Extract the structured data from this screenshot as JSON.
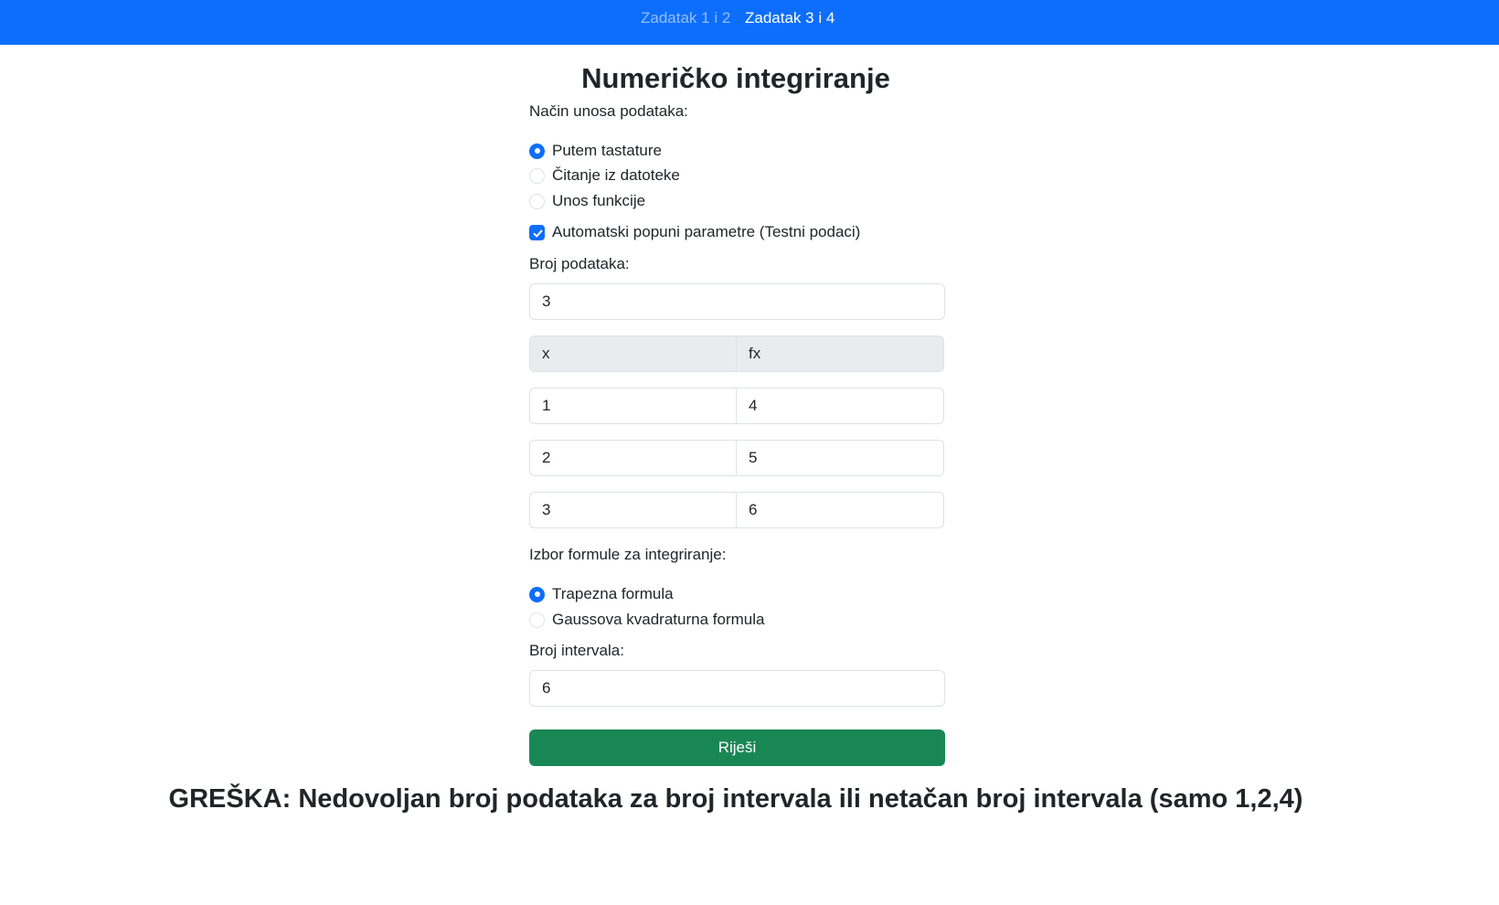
{
  "nav": {
    "links": [
      {
        "label": "Zadatak 1 i 2",
        "active": false
      },
      {
        "label": "Zadatak 3 i 4",
        "active": true
      }
    ]
  },
  "title": "Numeričko integriranje",
  "input_mode": {
    "label": "Način unosa podataka:",
    "options": [
      {
        "label": "Putem tastature",
        "checked": true
      },
      {
        "label": "Čitanje iz datoteke",
        "checked": false
      },
      {
        "label": "Unos funkcije",
        "checked": false
      }
    ]
  },
  "autofill": {
    "label": "Automatski popuni parametre (Testni podaci)",
    "checked": true
  },
  "data_count": {
    "label": "Broj podataka:",
    "value": "3"
  },
  "table": {
    "headers": [
      "x",
      "fx"
    ],
    "rows": [
      [
        "1",
        "4"
      ],
      [
        "2",
        "5"
      ],
      [
        "3",
        "6"
      ]
    ]
  },
  "formula": {
    "label": "Izbor formule za integriranje:",
    "options": [
      {
        "label": "Trapezna formula",
        "checked": true
      },
      {
        "label": "Gaussova kvadraturna formula",
        "checked": false
      }
    ]
  },
  "intervals": {
    "label": "Broj intervala:",
    "value": "6"
  },
  "solve_label": "Riješi",
  "error": "GREŠKA: Nedovoljan broj podataka za broj intervala ili netačan broj intervala (samo 1,2,4)",
  "colors": {
    "primary": "#0d6efd",
    "success": "#198754",
    "header_bg": "#e9ecef"
  }
}
